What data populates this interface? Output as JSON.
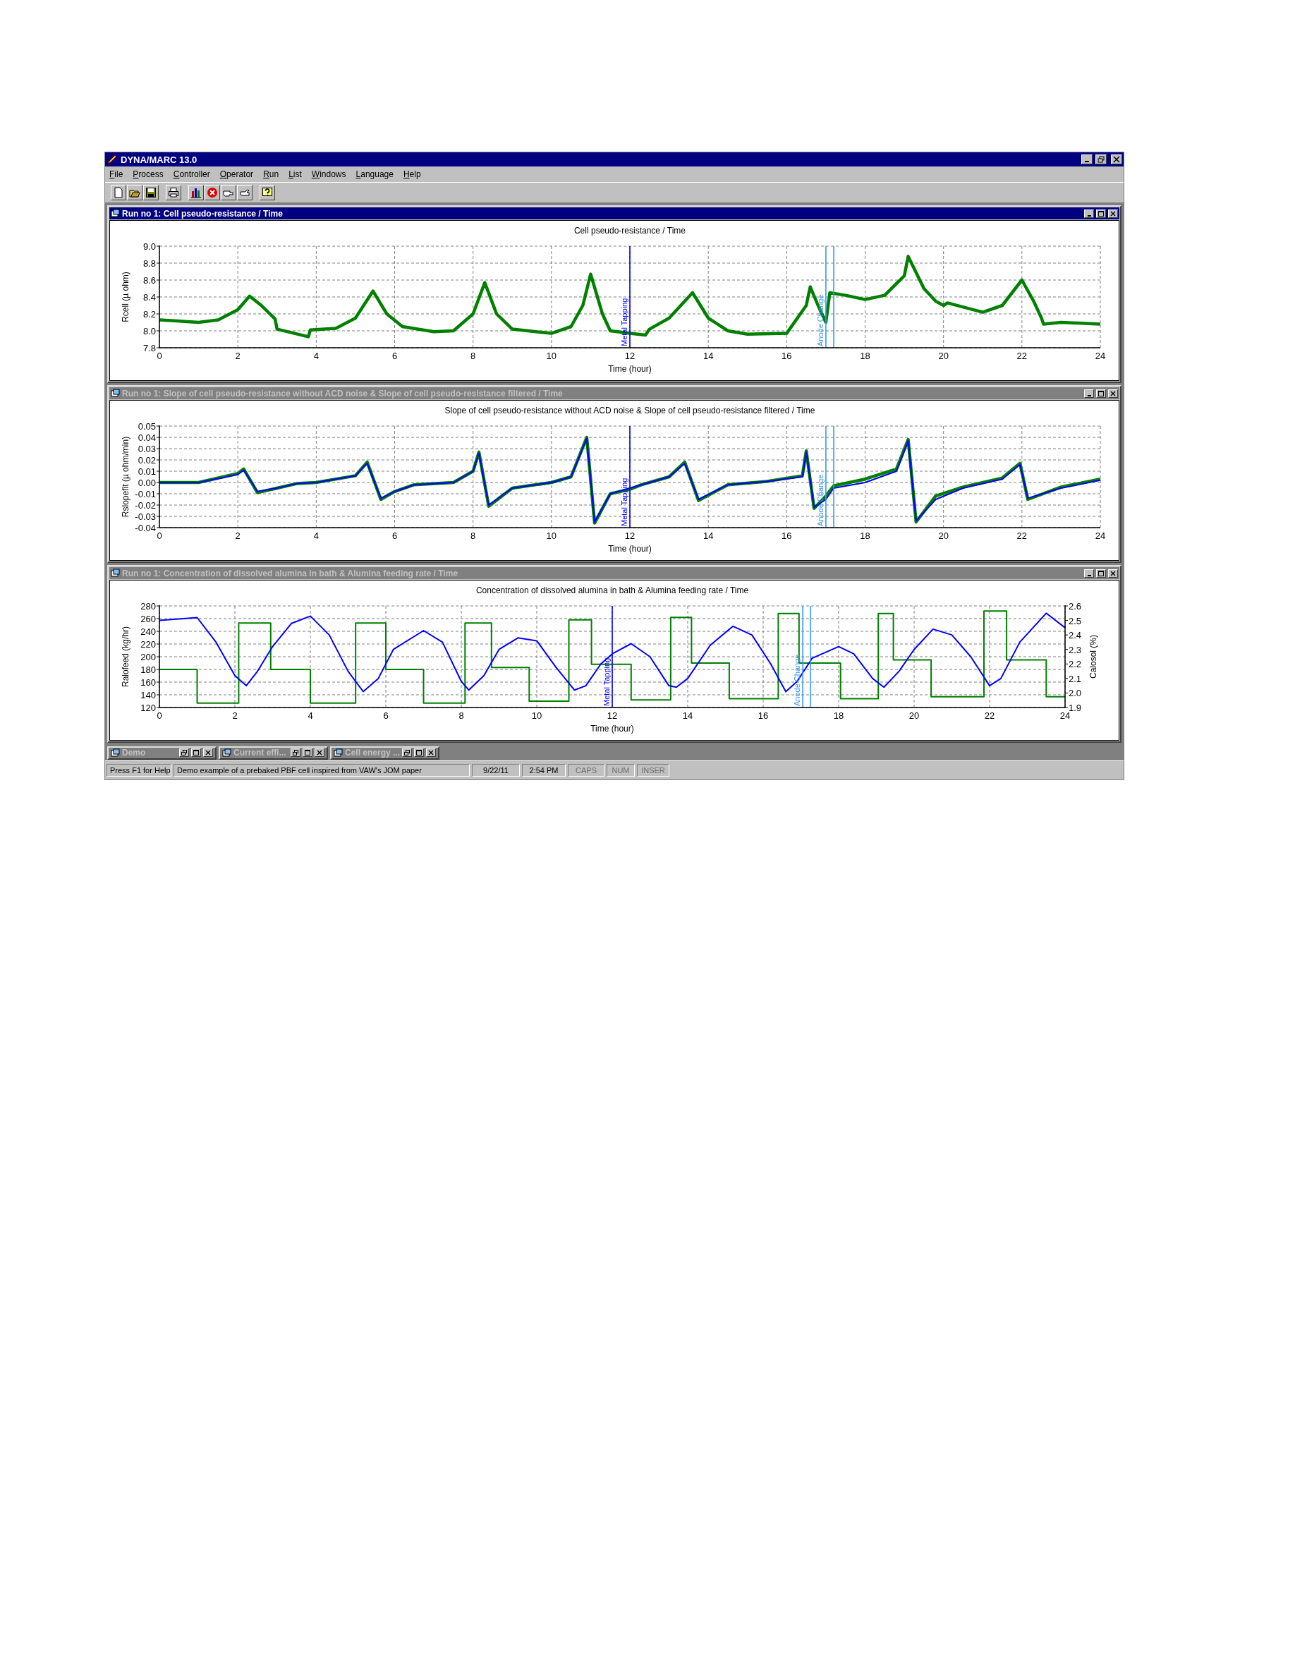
{
  "window": {
    "title": "DYNA/MARC 13.0"
  },
  "menu": [
    "File",
    "Process",
    "Controller",
    "Operator",
    "Run",
    "List",
    "Windows",
    "Language",
    "Help"
  ],
  "panels": [
    {
      "title": "Run no 1: Cell pseudo-resistance / Time",
      "active": true,
      "chart_data": {
        "type": "line",
        "title": "Cell pseudo-resistance / Time",
        "xlabel": "Time (hour)",
        "ylabel": "Rcell (µ ohm)",
        "xlim": [
          0,
          24
        ],
        "ylim": [
          7.8,
          9.0
        ],
        "xticks": [
          0,
          2,
          4,
          6,
          8,
          10,
          12,
          14,
          16,
          18,
          20,
          22,
          24
        ],
        "yticks": [
          {
            "value": 7.8,
            "label": "7.8"
          },
          {
            "value": 8,
            "label": "8.0"
          },
          {
            "value": 8.2,
            "label": "8.2"
          },
          {
            "value": 8.4,
            "label": "8.4"
          },
          {
            "value": 8.6,
            "label": "8.6"
          },
          {
            "value": 8.8,
            "label": "8.8"
          },
          {
            "value": 9,
            "label": "9.0"
          }
        ],
        "series": [
          {
            "color": "#008000",
            "x": [
              0,
              1,
              1.5,
              2,
              2.3,
              2.6,
              2.95,
              3.0,
              3.8,
              3.85,
              4.5,
              5,
              5.45,
              5.8,
              6.2,
              7,
              7.5,
              8,
              8.3,
              8.6,
              9,
              10,
              10.5,
              10.8,
              11,
              11.3,
              11.5,
              12,
              12.4,
              12.5,
              13,
              13.6,
              14,
              14.5,
              15,
              16,
              16.5,
              16.6,
              16.8,
              17.0,
              17.1,
              17.5,
              18,
              18.5,
              19,
              19.1,
              19.5,
              19.8,
              20,
              20.1,
              21,
              21.5,
              22,
              22.3,
              22.5,
              22.55,
              23,
              24
            ],
            "values": [
              8.13,
              8.1,
              8.13,
              8.25,
              8.41,
              8.3,
              8.14,
              8.02,
              7.93,
              8.01,
              8.03,
              8.15,
              8.47,
              8.2,
              8.05,
              7.99,
              8.0,
              8.2,
              8.57,
              8.2,
              8.02,
              7.97,
              8.05,
              8.3,
              8.67,
              8.2,
              8.0,
              7.97,
              7.95,
              8.02,
              8.15,
              8.45,
              8.15,
              8.0,
              7.96,
              7.97,
              8.3,
              8.52,
              8.3,
              8.1,
              8.45,
              8.42,
              8.37,
              8.42,
              8.65,
              8.88,
              8.5,
              8.35,
              8.3,
              8.33,
              8.22,
              8.3,
              8.6,
              8.35,
              8.15,
              8.08,
              8.1,
              8.08
            ]
          }
        ],
        "grid": true,
        "ref_lines": [
          {
            "axis": "x",
            "value": 12,
            "label": "Metal Tapping",
            "color": "#0000ff"
          },
          {
            "axis": "x",
            "value": 17.0,
            "label": "Anode Change",
            "color": "#3399ff"
          },
          {
            "axis": "x",
            "value": 17.2,
            "color": "#3399ff"
          }
        ]
      }
    },
    {
      "title": "Run no 1: Slope of cell pseudo-resistance without ACD noise & Slope of cell pseudo-resistance filtered / Time",
      "active": false,
      "chart_data": {
        "type": "line",
        "title": "Slope of cell pseudo-resistance without ACD noise & Slope of cell pseudo-resistance filtered / Time",
        "xlabel": "Time (hour)",
        "ylabel": "Rslopefit (µ ohm/min)",
        "xlim": [
          0,
          24
        ],
        "ylim": [
          -0.04,
          0.05
        ],
        "xticks": [
          0,
          2,
          4,
          6,
          8,
          10,
          12,
          14,
          16,
          18,
          20,
          22,
          24
        ],
        "yticks": [
          {
            "value": -0.04,
            "label": "-0.04"
          },
          {
            "value": -0.03,
            "label": "-0.03"
          },
          {
            "value": -0.02,
            "label": "-0.02"
          },
          {
            "value": -0.01,
            "label": "-0.01"
          },
          {
            "value": 0,
            "label": "0.00"
          },
          {
            "value": 0.01,
            "label": "0.01"
          },
          {
            "value": 0.02,
            "label": "0.02"
          },
          {
            "value": 0.03,
            "label": "0.03"
          },
          {
            "value": 0.04,
            "label": "0.04"
          },
          {
            "value": 0.05,
            "label": "0.05"
          }
        ],
        "series": [
          {
            "color": "#008000",
            "x": [
              0,
              1,
              2,
              2.15,
              2.5,
              3,
              3.5,
              4,
              5,
              5.3,
              5.65,
              6,
              6.5,
              7.5,
              8,
              8.15,
              8.4,
              9,
              10,
              10.5,
              10.9,
              11.1,
              11.5,
              12,
              12.3,
              13,
              13.4,
              13.75,
              14.5,
              15.5,
              16.4,
              16.5,
              16.7,
              17.0,
              17.2,
              18,
              18.8,
              19.1,
              19.3,
              19.8,
              20.5,
              21.5,
              21.95,
              22.15,
              23,
              24
            ],
            "values": [
              0,
              0,
              0.008,
              0.012,
              -0.009,
              -0.005,
              -0.001,
              0,
              0.006,
              0.018,
              -0.015,
              -0.008,
              -0.002,
              0,
              0.01,
              0.027,
              -0.021,
              -0.005,
              0,
              0.005,
              0.04,
              -0.036,
              -0.01,
              -0.006,
              -0.002,
              0.005,
              0.018,
              -0.016,
              -0.002,
              0.001,
              0.006,
              0.028,
              -0.023,
              -0.012,
              -0.003,
              0.003,
              0.012,
              0.038,
              -0.035,
              -0.012,
              -0.004,
              0.004,
              0.017,
              -0.015,
              -0.004,
              0.003
            ]
          },
          {
            "color": "#0000ff",
            "x": [
              0,
              1,
              2,
              2.15,
              2.5,
              3,
              3.5,
              4,
              5,
              5.3,
              5.65,
              6,
              6.5,
              7.5,
              8,
              8.15,
              8.4,
              9,
              10,
              10.5,
              10.9,
              11.1,
              11.5,
              12,
              12.3,
              13,
              13.4,
              13.75,
              14.5,
              15.5,
              16.4,
              16.5,
              16.7,
              17.0,
              17.2,
              18,
              18.8,
              19.1,
              19.3,
              19.8,
              20.5,
              21.5,
              21.95,
              22.15,
              23,
              24
            ],
            "values": [
              0,
              0,
              0.007,
              0.011,
              -0.008,
              -0.005,
              -0.001,
              0,
              0.006,
              0.017,
              -0.014,
              -0.008,
              -0.002,
              0,
              0.01,
              0.026,
              -0.02,
              -0.005,
              0,
              0.005,
              0.039,
              -0.035,
              -0.01,
              -0.005,
              -0.002,
              0.005,
              0.017,
              -0.015,
              -0.002,
              0.001,
              0.005,
              0.027,
              -0.022,
              -0.015,
              -0.005,
              0,
              0.01,
              0.037,
              -0.034,
              -0.015,
              -0.005,
              0.003,
              0.016,
              -0.014,
              -0.005,
              0.002
            ]
          }
        ],
        "grid": true,
        "ref_lines": [
          {
            "axis": "x",
            "value": 12,
            "label": "Metal Tapping",
            "color": "#0000ff"
          },
          {
            "axis": "x",
            "value": 17.0,
            "label": "Anode Change",
            "color": "#3399ff"
          },
          {
            "axis": "x",
            "value": 17.2,
            "color": "#3399ff"
          }
        ]
      }
    },
    {
      "title": "Run no 1: Concentration of dissolved alumina in bath & Alumina feeding rate / Time",
      "active": false,
      "chart_data": {
        "type": "line",
        "title": "Concentration of dissolved alumina in bath & Alumina feeding rate / Time",
        "xlabel": "Time (hour)",
        "ylabel": "Ralofeed (kg/hr)",
        "y2label": "Calosol (%)",
        "xlim": [
          0,
          24
        ],
        "ylim": [
          120,
          280
        ],
        "y2lim": [
          1.9,
          2.6
        ],
        "xticks": [
          0,
          2,
          4,
          6,
          8,
          10,
          12,
          14,
          16,
          18,
          20,
          22,
          24
        ],
        "yticks": [
          120,
          140,
          160,
          180,
          200,
          220,
          240,
          260,
          280
        ],
        "y2ticks": [
          {
            "value": 1.9,
            "label": "1.9"
          },
          {
            "value": 2,
            "label": "2.0"
          },
          {
            "value": 2.1,
            "label": "2.1"
          },
          {
            "value": 2.2,
            "label": "2.2"
          },
          {
            "value": 2.3,
            "label": "2.3"
          },
          {
            "value": 2.4,
            "label": "2.4"
          },
          {
            "value": 2.5,
            "label": "2.5"
          },
          {
            "value": 2.6,
            "label": "2.6"
          }
        ],
        "series": [
          {
            "color": "#008000",
            "x": [
              0,
              1,
              1,
              2.1,
              2.1,
              2.95,
              2.95,
              4,
              4,
              5.2,
              5.2,
              6,
              6,
              7,
              7,
              8.1,
              8.1,
              8.8,
              8.8,
              9.8,
              9.8,
              10.85,
              10.85,
              11.45,
              11.45,
              12.5,
              12.5,
              13.55,
              13.55,
              14.1,
              14.1,
              15.1,
              15.1,
              16.4,
              16.4,
              16.95,
              16.95,
              18.05,
              18.05,
              19.05,
              19.05,
              19.45,
              19.45,
              20.45,
              20.45,
              21.85,
              21.85,
              22.45,
              22.45,
              23.5,
              23.5,
              24
            ],
            "values": [
              180,
              180,
              127,
              127,
              253,
              253,
              180,
              180,
              127,
              127,
              253,
              253,
              180,
              180,
              127,
              127,
              253,
              253,
              183,
              183,
              130,
              130,
              258,
              258,
              188,
              188,
              132,
              132,
              262,
              262,
              190,
              190,
              134,
              134,
              268,
              268,
              190,
              190,
              134,
              134,
              268,
              268,
              195,
              195,
              137,
              137,
              272,
              272,
              195,
              195,
              137,
              137
            ]
          },
          {
            "color": "#0000ff",
            "axis": "y2",
            "x": [
              0,
              1,
              1.5,
              2,
              2.3,
              2.6,
              3,
              3.5,
              4,
              4.5,
              5,
              5.4,
              5.8,
              6.2,
              7,
              7.5,
              8,
              8.2,
              8.6,
              9,
              9.5,
              10,
              10.5,
              11,
              11.3,
              11.7,
              12,
              12.5,
              13,
              13.5,
              13.7,
              14,
              14.6,
              15.2,
              15.7,
              16.2,
              16.6,
              16.9,
              17.3,
              18,
              18.4,
              18.9,
              19.2,
              19.6,
              20,
              20.5,
              21,
              21.5,
              22,
              22.3,
              22.8,
              23.5,
              24
            ],
            "values": [
              2.5,
              2.52,
              2.35,
              2.12,
              2.05,
              2.15,
              2.32,
              2.48,
              2.53,
              2.4,
              2.15,
              2.01,
              2.1,
              2.3,
              2.43,
              2.35,
              2.08,
              2.02,
              2.12,
              2.3,
              2.38,
              2.36,
              2.18,
              2.02,
              2.05,
              2.2,
              2.27,
              2.34,
              2.25,
              2.05,
              2.04,
              2.1,
              2.33,
              2.46,
              2.4,
              2.2,
              2.01,
              2.08,
              2.24,
              2.32,
              2.27,
              2.1,
              2.04,
              2.15,
              2.3,
              2.44,
              2.4,
              2.25,
              2.05,
              2.1,
              2.35,
              2.55,
              2.45
            ]
          }
        ],
        "grid": true,
        "ref_lines": [
          {
            "axis": "x",
            "value": 12,
            "label": "Metal Tapping",
            "color": "#0000ff"
          },
          {
            "axis": "x",
            "value": 17.05,
            "label": "Anode Change",
            "color": "#3399ff"
          },
          {
            "axis": "x",
            "value": 17.25,
            "color": "#3399ff"
          }
        ]
      }
    }
  ],
  "minimized": [
    {
      "title": "Demo"
    },
    {
      "title": "Current effi..."
    },
    {
      "title": "Cell energy ..."
    }
  ],
  "status_bar": [
    {
      "text": "Press F1 for Help",
      "disabled": false
    },
    {
      "text": "Demo example of a prebaked PBF cell inspired from VAW's JOM paper",
      "disabled": false
    },
    {
      "text": "9/22/11",
      "disabled": false
    },
    {
      "text": "2:54 PM",
      "disabled": false
    },
    {
      "text": "CAPS",
      "disabled": true
    },
    {
      "text": "NUM",
      "disabled": true
    },
    {
      "text": "INSER",
      "disabled": true
    }
  ]
}
